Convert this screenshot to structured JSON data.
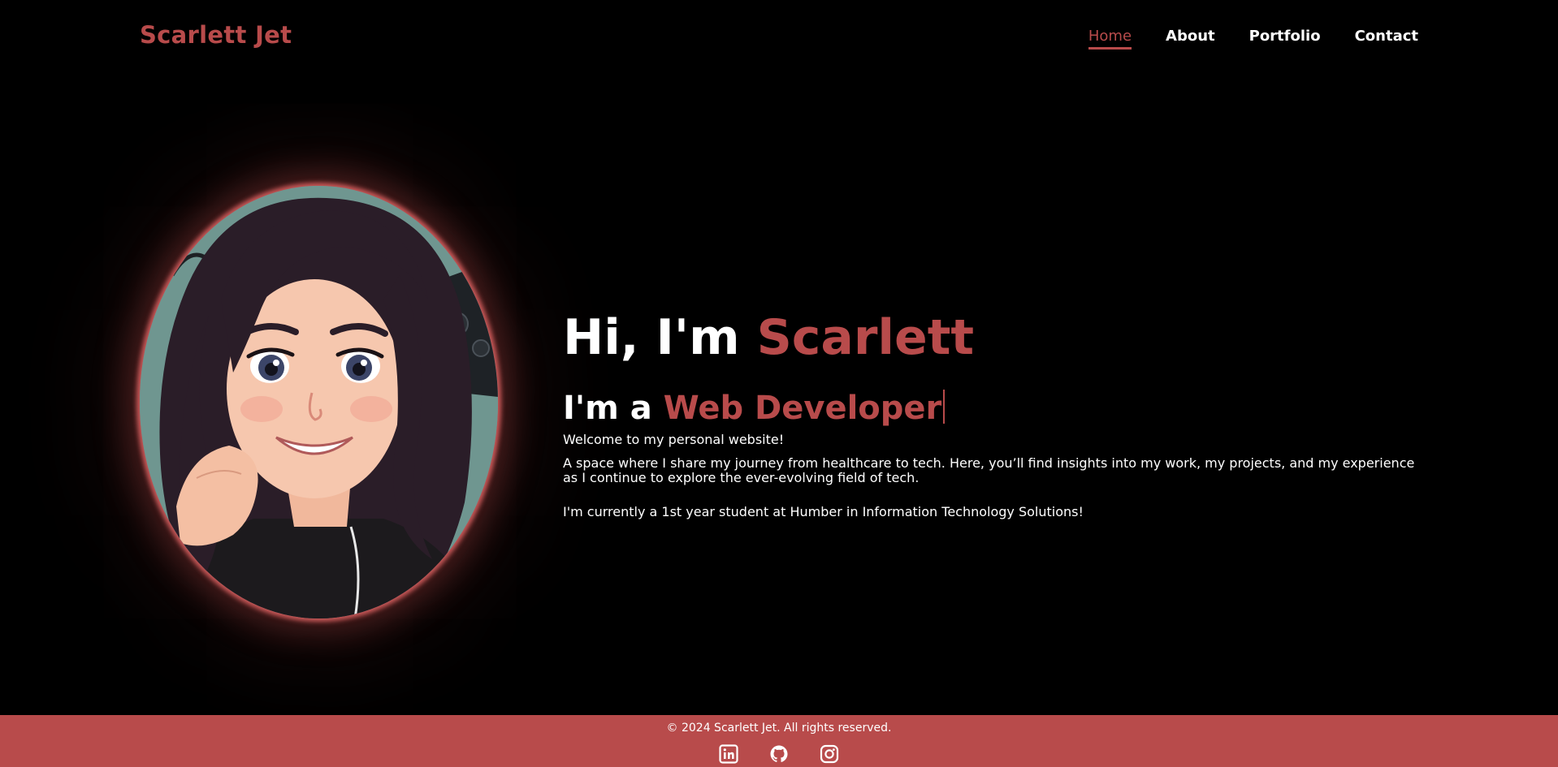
{
  "header": {
    "logo": "Scarlett Jet",
    "nav": [
      {
        "label": "Home",
        "active": true
      },
      {
        "label": "About",
        "active": false
      },
      {
        "label": "Portfolio",
        "active": false
      },
      {
        "label": "Contact",
        "active": false
      }
    ]
  },
  "hero": {
    "greeting_prefix": "Hi, I'm ",
    "greeting_name": "Scarlett",
    "role_prefix": "I'm a ",
    "role_title": "Web Developer",
    "welcome": "Welcome to my personal website!",
    "intro": "A space where I share my journey from healthcare to tech. Here, you’ll find insights into my work, my projects, and my experience as I continue to explore the ever-evolving field of tech.",
    "student": "I'm currently a 1st year student at Humber in Information Technology Solutions!"
  },
  "footer": {
    "copyright": "© 2024 Scarlett Jet. All rights reserved.",
    "social": [
      "linkedin-icon",
      "github-icon",
      "instagram-icon"
    ]
  },
  "colors": {
    "accent": "#b84b4b",
    "background": "#000000",
    "text": "#ffffff"
  }
}
